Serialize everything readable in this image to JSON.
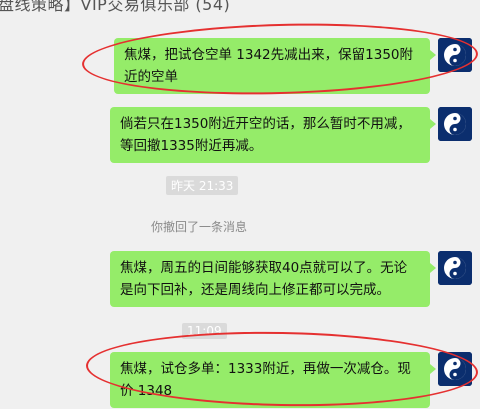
{
  "chat": {
    "title": "盘线策略】VIP交易俱乐部 (54)"
  },
  "messages": [
    {
      "text": "焦煤，把试仓空单 1342先减出来，保留1350附近的空单"
    },
    {
      "text": "倘若只在1350附近开空的话，那么暂时不用减，等回撤1335附近再减。"
    },
    {
      "text": "焦煤，周五的日间能够获取40点就可以了。无论是向下回补，还是周线向上修正都可以完成。"
    },
    {
      "text": "焦煤，试仓多单：1333附近，再做一次减仓。现价 1348"
    }
  ],
  "timestamps": [
    "昨天 21:33",
    "11:09"
  ],
  "system_notice": "你撤回了一条消息",
  "colors": {
    "bubble": "#95ec69",
    "background": "#f0f0f0",
    "annotation": "#e53030"
  },
  "icons": {
    "avatar": "yin-yang-icon"
  }
}
